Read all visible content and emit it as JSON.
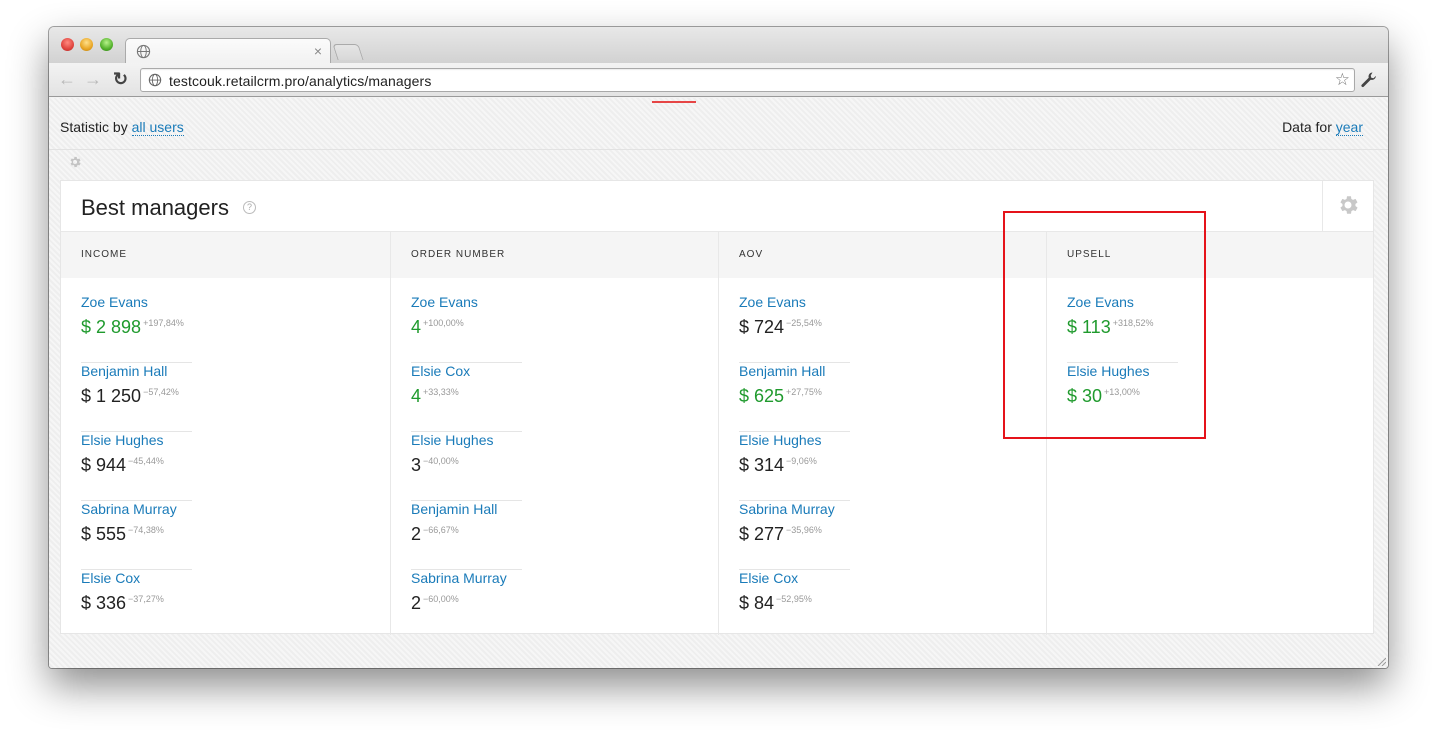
{
  "browser": {
    "url": "testcouk.retailcrm.pro/analytics/managers",
    "tab_close": "×"
  },
  "stats": {
    "left_prefix": "Statistic by ",
    "left_link": "all users",
    "right_prefix": "Data for ",
    "right_link": "year"
  },
  "panel": {
    "title": "Best managers",
    "help": "?",
    "columns": [
      {
        "title": "INCOME",
        "entries": [
          {
            "name": "Zoe Evans",
            "value": "$ 2 898",
            "change": "+197,84%",
            "positive": true
          },
          {
            "name": "Benjamin Hall",
            "value": "$ 1 250",
            "change": "−57,42%",
            "positive": false
          },
          {
            "name": "Elsie Hughes",
            "value": "$ 944",
            "change": "−45,44%",
            "positive": false
          },
          {
            "name": "Sabrina Murray",
            "value": "$ 555",
            "change": "−74,38%",
            "positive": false
          },
          {
            "name": "Elsie Cox",
            "value": "$ 336",
            "change": "−37,27%",
            "positive": false
          }
        ]
      },
      {
        "title": "ORDER NUMBER",
        "entries": [
          {
            "name": "Zoe Evans",
            "value": "4",
            "change": "+100,00%",
            "positive": true
          },
          {
            "name": "Elsie Cox",
            "value": "4",
            "change": "+33,33%",
            "positive": true
          },
          {
            "name": "Elsie Hughes",
            "value": "3",
            "change": "−40,00%",
            "positive": false
          },
          {
            "name": "Benjamin Hall",
            "value": "2",
            "change": "−66,67%",
            "positive": false
          },
          {
            "name": "Sabrina Murray",
            "value": "2",
            "change": "−60,00%",
            "positive": false
          }
        ]
      },
      {
        "title": "AOV",
        "entries": [
          {
            "name": "Zoe Evans",
            "value": "$ 724",
            "change": "−25,54%",
            "positive": false
          },
          {
            "name": "Benjamin Hall",
            "value": "$ 625",
            "change": "+27,75%",
            "positive": true
          },
          {
            "name": "Elsie Hughes",
            "value": "$ 314",
            "change": "−9,06%",
            "positive": false
          },
          {
            "name": "Sabrina Murray",
            "value": "$ 277",
            "change": "−35,96%",
            "positive": false
          },
          {
            "name": "Elsie Cox",
            "value": "$ 84",
            "change": "−52,95%",
            "positive": false
          }
        ]
      },
      {
        "title": "UPSELL",
        "entries": [
          {
            "name": "Zoe Evans",
            "value": "$ 113",
            "change": "+318,52%",
            "positive": true
          },
          {
            "name": "Elsie Hughes",
            "value": "$ 30",
            "change": "+13,00%",
            "positive": true
          }
        ]
      }
    ]
  },
  "colors": {
    "link": "#1a7bb9",
    "positive": "#1f9a2d",
    "highlight": "#e5131a"
  }
}
